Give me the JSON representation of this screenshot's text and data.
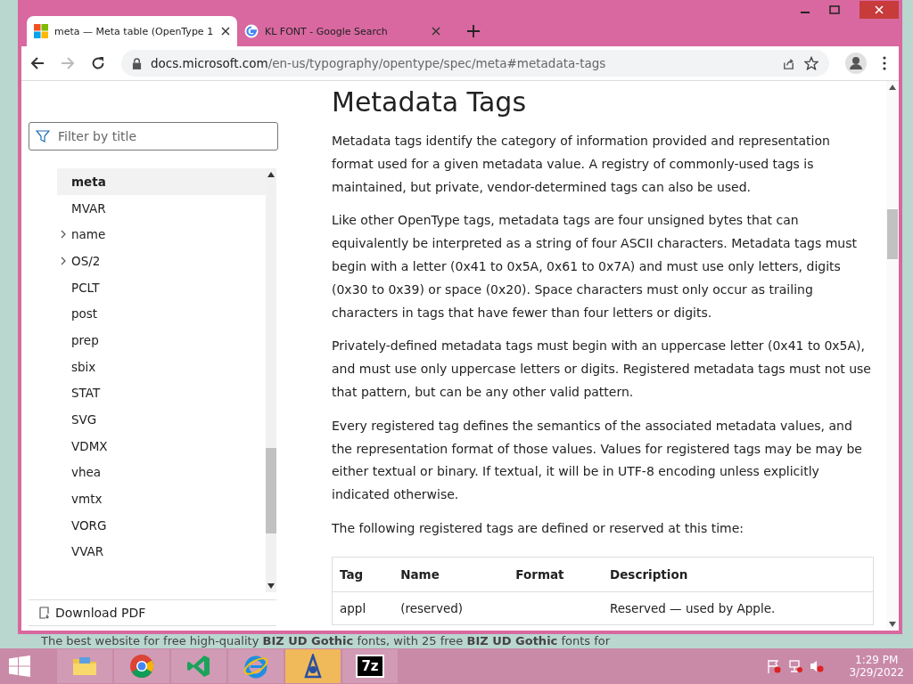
{
  "tabs": [
    {
      "title": "meta — Meta table (OpenType 1",
      "selected": true
    },
    {
      "title": "KL FONT - Google Search",
      "selected": false
    }
  ],
  "address": {
    "host": "docs.microsoft.com",
    "path": "/en-us/typography/opentype/spec/meta#metadata-tags"
  },
  "sidebar": {
    "filter_placeholder": "Filter by title",
    "items": [
      {
        "label": "meta",
        "selected": true,
        "expandable": false
      },
      {
        "label": "MVAR",
        "selected": false,
        "expandable": false
      },
      {
        "label": "name",
        "selected": false,
        "expandable": true
      },
      {
        "label": "OS/2",
        "selected": false,
        "expandable": true
      },
      {
        "label": "PCLT",
        "selected": false,
        "expandable": false
      },
      {
        "label": "post",
        "selected": false,
        "expandable": false
      },
      {
        "label": "prep",
        "selected": false,
        "expandable": false
      },
      {
        "label": "sbix",
        "selected": false,
        "expandable": false
      },
      {
        "label": "STAT",
        "selected": false,
        "expandable": false
      },
      {
        "label": "SVG",
        "selected": false,
        "expandable": false
      },
      {
        "label": "VDMX",
        "selected": false,
        "expandable": false
      },
      {
        "label": "vhea",
        "selected": false,
        "expandable": false
      },
      {
        "label": "vmtx",
        "selected": false,
        "expandable": false
      },
      {
        "label": "VORG",
        "selected": false,
        "expandable": false
      },
      {
        "label": "VVAR",
        "selected": false,
        "expandable": false
      }
    ],
    "download": "Download PDF"
  },
  "article": {
    "heading": "Metadata Tags",
    "paragraphs": [
      "Metadata tags identify the category of information provided and representation format used for a given metadata value. A registry of commonly-used tags is maintained, but private, vendor-determined tags can also be used.",
      "Like other OpenType tags, metadata tags are four unsigned bytes that can equivalently be interpreted as a string of four ASCII characters. Metadata tags must begin with a letter (0x41 to 0x5A, 0x61 to 0x7A) and must use only letters, digits (0x30 to 0x39) or space (0x20). Space characters must only occur as trailing characters in tags that have fewer than four letters or digits.",
      "Privately-defined metadata tags must begin with an uppercase letter (0x41 to 0x5A), and must use only uppercase letters or digits. Registered metadata tags must not use that pattern, but can be any other valid pattern.",
      "Every registered tag defines the semantics of the associated metadata values, and the representation format of those values. Values for registered tags may be may be either textual or binary. If textual, it will be in UTF-8 encoding unless explicitly indicated otherwise.",
      "The following registered tags are defined or reserved at this time:"
    ],
    "table": {
      "columns": [
        "Tag",
        "Name",
        "Format",
        "Description"
      ],
      "rows": [
        [
          "appl",
          "(reserved)",
          "",
          "Reserved — used by Apple."
        ]
      ]
    }
  },
  "background_text": "The best website for free high-quality **BIZ UD Gothic** fonts, with 25 free **BIZ UD Gothic** fonts for",
  "taskbar": {
    "apps": [
      {
        "kind": "folder",
        "selected": false
      },
      {
        "kind": "chrome",
        "selected": false
      },
      {
        "kind": "code",
        "selected": false
      },
      {
        "kind": "ie",
        "selected": false
      },
      {
        "kind": "font",
        "selected": true
      },
      {
        "kind": "archive",
        "label": "7z",
        "selected": false
      }
    ],
    "time": "1:29 PM",
    "date": "3/29/2022"
  }
}
